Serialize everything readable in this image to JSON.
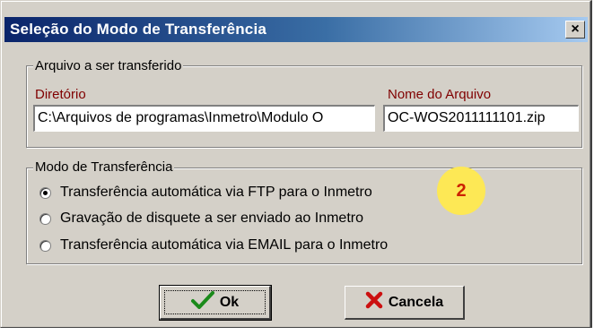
{
  "window": {
    "title": "Seleção do Modo de Transferência",
    "close_label": "×"
  },
  "arquivo_group": {
    "legend": "Arquivo a ser transferido",
    "diretorio_label": "Diretório",
    "diretorio_value": "C:\\Arquivos de programas\\Inmetro\\Modulo O",
    "nome_label": "Nome do Arquivo",
    "nome_value": "OC-WOS2011111101.zip"
  },
  "modo_group": {
    "legend": "Modo de Transferência",
    "options": [
      {
        "label": "Transferência automática via FTP para o Inmetro",
        "selected": true
      },
      {
        "label": "Gravação de disquete a ser enviado ao Inmetro",
        "selected": false
      },
      {
        "label": "Transferência automática via EMAIL para o Inmetro",
        "selected": false
      }
    ]
  },
  "annotation": {
    "badge": "2"
  },
  "buttons": {
    "ok_label": "Ok",
    "cancel_label": "Cancela"
  },
  "colors": {
    "title_start": "#0a246a",
    "title_end": "#a6caf0",
    "label_color": "#800000",
    "badge_bg": "#fde855",
    "badge_text": "#cc2200"
  },
  "icons": {
    "ok": "checkmark-icon",
    "cancel": "x-icon"
  }
}
